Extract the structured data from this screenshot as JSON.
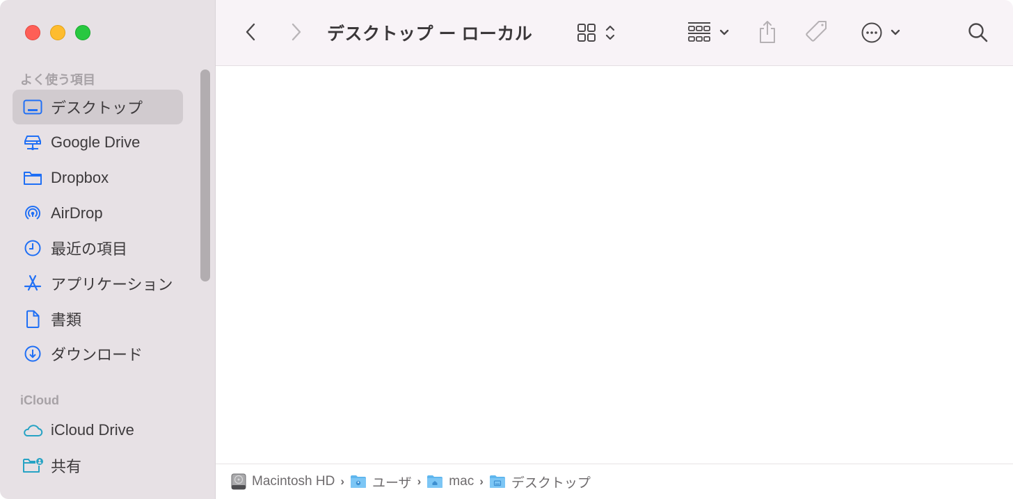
{
  "window": {
    "title": "デスクトップ ー ローカル",
    "traffic_lights": {
      "close": "#fe5f57",
      "minimize": "#febc2e",
      "maximize": "#28c840"
    }
  },
  "sidebar": {
    "sections": [
      {
        "header": "よく使う項目",
        "items": [
          {
            "label": "デスクトップ",
            "icon": "desktop-icon",
            "selected": true
          },
          {
            "label": "Google Drive",
            "icon": "network-drive-icon"
          },
          {
            "label": "Dropbox",
            "icon": "folder-icon"
          },
          {
            "label": "AirDrop",
            "icon": "airdrop-icon"
          },
          {
            "label": "最近の項目",
            "icon": "clock-icon"
          },
          {
            "label": "アプリケーション",
            "icon": "applications-icon"
          },
          {
            "label": "書類",
            "icon": "document-icon"
          },
          {
            "label": "ダウンロード",
            "icon": "download-icon"
          }
        ]
      },
      {
        "header": "iCloud",
        "items": [
          {
            "label": "iCloud Drive",
            "icon": "cloud-icon"
          },
          {
            "label": "共有",
            "icon": "shared-folder-icon"
          }
        ]
      }
    ],
    "accent_color": "#1f6ff5",
    "icloud_color": "#27a3c4"
  },
  "toolbar": {
    "back": "back-icon",
    "forward": "forward-icon",
    "view_mode": "icon-view-icon",
    "group": "group-icon",
    "share": "share-icon",
    "tag": "tag-icon",
    "more": "more-icon",
    "search": "search-icon"
  },
  "pathbar": {
    "crumbs": [
      {
        "label": "Macintosh HD",
        "icon": "hard-disk-icon"
      },
      {
        "label": "ユーザ",
        "icon": "users-folder-icon"
      },
      {
        "label": "mac",
        "icon": "home-folder-icon"
      },
      {
        "label": "デスクトップ",
        "icon": "desktop-folder-icon"
      }
    ],
    "separator": "›"
  }
}
